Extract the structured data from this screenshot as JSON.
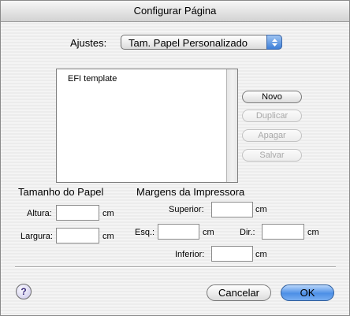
{
  "window": {
    "title": "Configurar Página"
  },
  "settings": {
    "label": "Ajustes:",
    "selected": "Tam. Papel Personalizado"
  },
  "paper_list": {
    "items": [
      "EFI template"
    ]
  },
  "side_buttons": {
    "new": "Novo",
    "duplicate": "Duplicar",
    "delete": "Apagar",
    "save": "Salvar"
  },
  "paper_size": {
    "heading": "Tamanho do Papel",
    "height_label": "Altura:",
    "width_label": "Largura:",
    "height_value": "",
    "width_value": "",
    "unit": "cm"
  },
  "margins": {
    "heading": "Margens da Impressora",
    "top_label": "Superior:",
    "left_label": "Esq.:",
    "right_label": "Dir.:",
    "bottom_label": "Inferior:",
    "top_value": "",
    "left_value": "",
    "right_value": "",
    "bottom_value": "",
    "unit": "cm"
  },
  "footer": {
    "help": "?",
    "cancel": "Cancelar",
    "ok": "OK"
  },
  "colors": {
    "default_button": "#4c8fe6",
    "popup_arrow": "#3d7fd8",
    "disabled_text": "#a8a8a8"
  }
}
